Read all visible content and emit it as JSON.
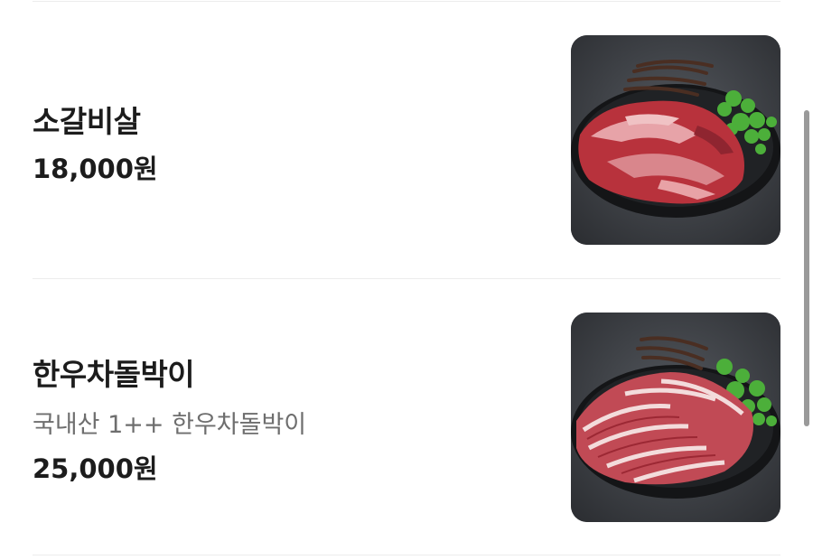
{
  "menu": {
    "items": [
      {
        "name": "소갈비살",
        "description": "",
        "price": "18,000원",
        "image_icon": "beef-short-rib-photo"
      },
      {
        "name": "한우차돌박이",
        "description": "국내산 1++ 한우차돌박이",
        "price": "25,000원",
        "image_icon": "beef-brisket-photo"
      }
    ]
  },
  "colors": {
    "text_primary": "#1c1c1c",
    "text_secondary": "#6e6e6e",
    "divider": "#ececec",
    "scrollbar": "#9a9a9a"
  }
}
